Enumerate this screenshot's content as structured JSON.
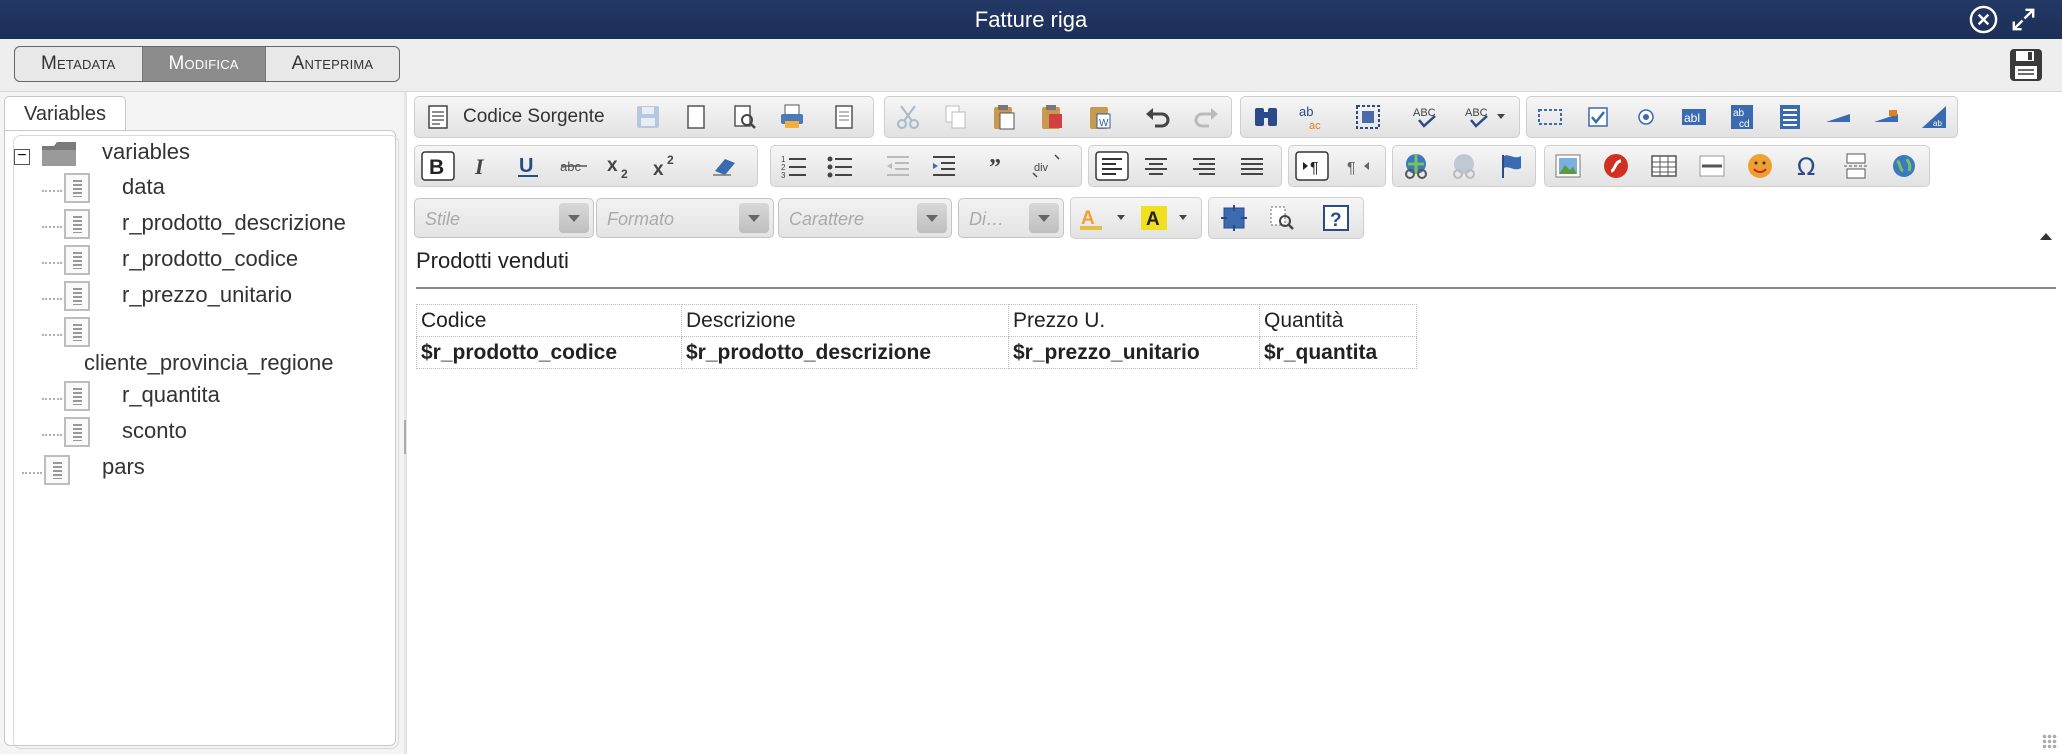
{
  "window": {
    "title": "Fatture riga",
    "close_icon": "close-circle-icon",
    "expand_icon": "expand-arrows-icon"
  },
  "modes": {
    "tabs": [
      {
        "label": "Metadata",
        "active": false
      },
      {
        "label": "Modifica",
        "active": true
      },
      {
        "label": "Anteprima",
        "active": false
      }
    ],
    "save_icon": "floppy-disk-icon"
  },
  "variables_panel": {
    "tab_label": "Variables",
    "root": "variables",
    "items": [
      "data",
      "r_prodotto_descrizione",
      "r_prodotto_codice",
      "r_prezzo_unitario",
      "cliente_provincia_regione",
      "r_quantita",
      "sconto"
    ],
    "extra": "pars"
  },
  "toolbar": {
    "source_button": "Codice Sorgente",
    "combos": {
      "style": "Stile",
      "format": "Formato",
      "font": "Carattere",
      "size": "Di…"
    }
  },
  "content": {
    "heading": "Prodotti venduti",
    "table": {
      "headers": [
        "Codice",
        "Descrizione",
        "Prezzo U.",
        "Quantità"
      ],
      "row": [
        "$r_prodotto_codice",
        "$r_prodotto_descrizione",
        "$r_prezzo_unitario",
        "$r_quantita"
      ]
    }
  },
  "colors": {
    "titlebar": "#1f3360",
    "active_tab": "#8c8c8c"
  }
}
